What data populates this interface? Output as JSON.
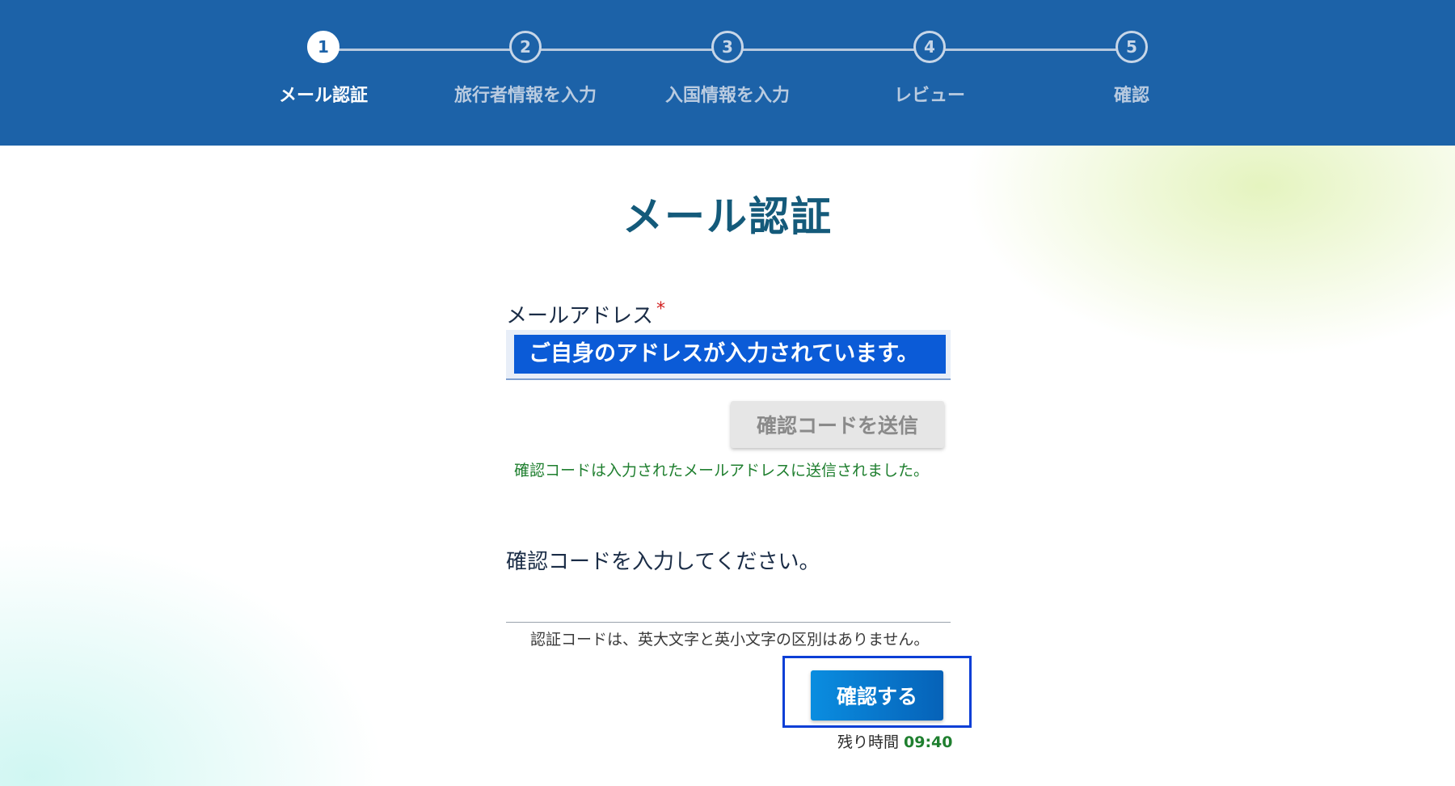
{
  "steps": [
    {
      "number": "1",
      "label": "メール認証",
      "active": true
    },
    {
      "number": "2",
      "label": "旅行者情報を入力",
      "active": false
    },
    {
      "number": "3",
      "label": "入国情報を入力",
      "active": false
    },
    {
      "number": "4",
      "label": "レビュー",
      "active": false
    },
    {
      "number": "5",
      "label": "確認",
      "active": false
    }
  ],
  "main": {
    "title": "メール認証",
    "email": {
      "label": "メールアドレス",
      "required_mark": "*",
      "value": "ご自身のアドレスが入力されています。"
    },
    "send_button_label": "確認コードを送信",
    "sent_message": "確認コードは入力されたメールアドレスに送信されました。",
    "code": {
      "label": "確認コードを入力してください。",
      "value": "",
      "note": "認証コードは、英大文字と英小文字の区別はありません。"
    },
    "confirm_button_label": "確認する",
    "timer": {
      "label": "残り時間",
      "value": "09:40"
    }
  },
  "colors": {
    "header_bg": "#1c62a8",
    "title": "#145a7a",
    "success_text": "#1f7f2f",
    "primary_button": "#0662b8",
    "focus_outline": "#0c3fd6",
    "required": "#d21f1f"
  }
}
